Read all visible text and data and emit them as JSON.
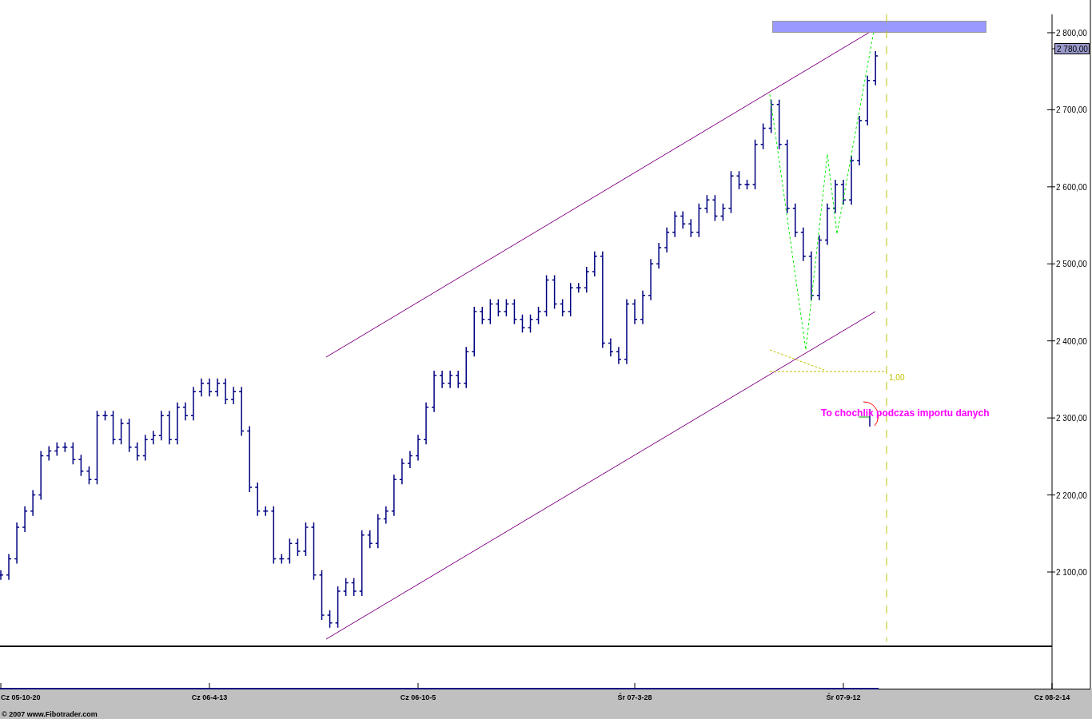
{
  "chart": {
    "y_axis_labels": [
      "2 800,00",
      "2 700,00",
      "2 600,00",
      "2 500,00",
      "2 400,00",
      "2 300,00",
      "2 200,00",
      "2 100,00"
    ],
    "date_labels": [
      "Cz 05-10-20",
      "Cz 06-4-13",
      "Cz 06-10-5",
      "Śr 07-3-28",
      "Śr 07-9-12",
      "Cz 08-2-14"
    ],
    "annotations": [
      {
        "text": "1,00"
      },
      {
        "text": "To chochlik podczas importu danych"
      }
    ],
    "price_label": "2 780,00"
  },
  "footer": "© 2007 www.Fibotrader.com"
}
